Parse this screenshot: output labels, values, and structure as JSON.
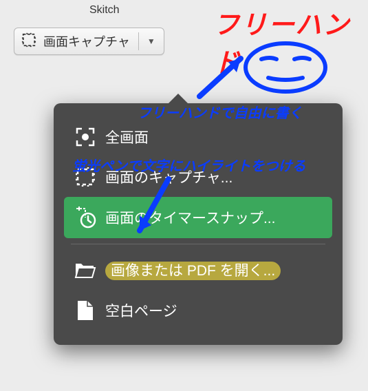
{
  "titlebar": {
    "app_name": "Skitch"
  },
  "toolbar": {
    "capture_button_label": "画面キャプチャ"
  },
  "menu": {
    "items": [
      {
        "label": "全画面"
      },
      {
        "label": "画面のキャプチャ..."
      },
      {
        "label": "画面のタイマースナップ..."
      },
      {
        "label": "画像または PDF を開く..."
      },
      {
        "label": "空白ページ"
      }
    ]
  },
  "annotations": {
    "freehand_title": "フリーハンド",
    "freehand_caption": "フリーハンドで自由に書く",
    "highlight_caption": "蛍光ペンで文字にハイライトをつける"
  },
  "colors": {
    "annotation_red": "#ff1a1a",
    "annotation_blue": "#0a3cff",
    "menu_selected": "#3ba85c",
    "highlight_yellow": "#dcc83c"
  }
}
